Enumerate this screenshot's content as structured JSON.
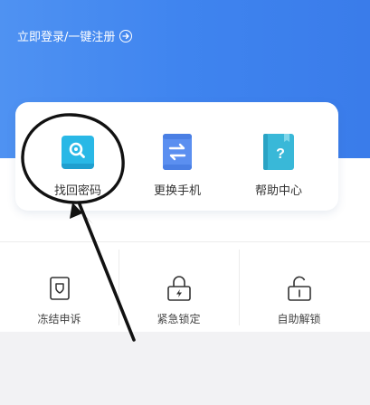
{
  "header": {
    "login_text": "立即登录/一键注册",
    "arrow_icon": "arrow-right-circle-icon",
    "background_color": "#4189ef"
  },
  "quick_actions": [
    {
      "label": "找回密码",
      "icon": "search-card-icon",
      "color": "#29b8e6"
    },
    {
      "label": "更换手机",
      "icon": "swap-phone-icon",
      "color": "#5b8ff0"
    },
    {
      "label": "帮助中心",
      "icon": "help-book-icon",
      "color": "#39b8d8"
    }
  ],
  "services": [
    {
      "label": "冻结申诉",
      "icon": "shield-icon"
    },
    {
      "label": "紧急锁定",
      "icon": "lock-bolt-icon"
    },
    {
      "label": "自助解锁",
      "icon": "unlock-icon"
    }
  ],
  "annotation": {
    "description_icon": "hand-drawn-circle-and-arrow",
    "color": "#111111"
  }
}
